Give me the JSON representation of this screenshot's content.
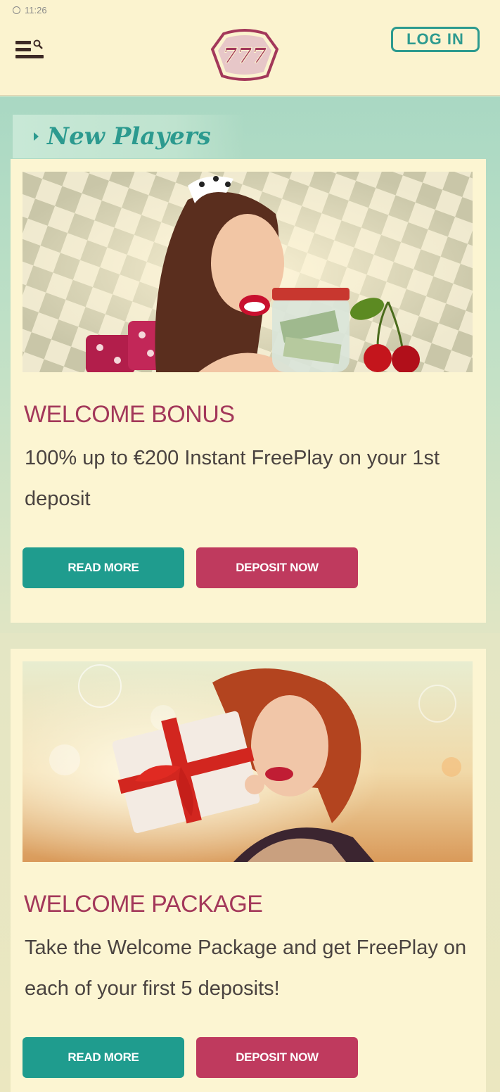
{
  "status_bar": {
    "time": "11:26"
  },
  "header": {
    "logo_text": "777",
    "login_label": "LOG IN"
  },
  "section": {
    "title": "New Players"
  },
  "promos": [
    {
      "title": "WELCOME BONUS",
      "description": "100% up to €200 Instant FreePlay on your 1st deposit",
      "read_more_label": "READ MORE",
      "deposit_label": "DEPOSIT NOW"
    },
    {
      "title": "WELCOME PACKAGE",
      "description": "Take the Welcome Package and get FreePlay on each of your first 5 deposits!",
      "read_more_label": "READ MORE",
      "deposit_label": "DEPOSIT NOW"
    }
  ],
  "colors": {
    "teal": "#1f9c8e",
    "crimson": "#bf3a5e",
    "cream": "#fbf3cf"
  }
}
